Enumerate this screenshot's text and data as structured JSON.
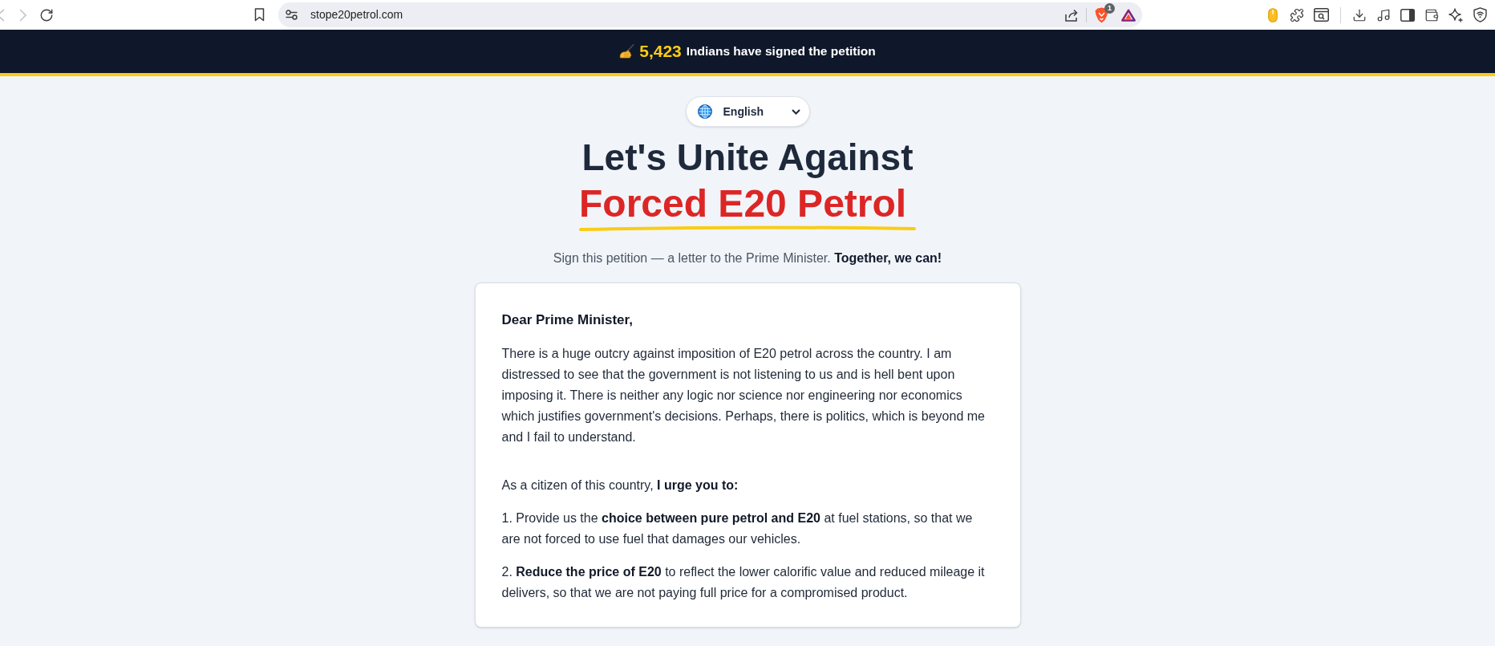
{
  "browser": {
    "nav_buttons": [
      {
        "kind": "back",
        "disabled": true
      },
      {
        "kind": "forward",
        "disabled": true
      },
      {
        "kind": "reload",
        "disabled": false
      }
    ],
    "url": "stope20petrol.com",
    "shields_badge": "1"
  },
  "banner": {
    "count": "5,423",
    "text": "Indians have signed the petition"
  },
  "language_select": {
    "value": "English"
  },
  "headline": {
    "line_1": "Let's Unite Against",
    "line_2": "Forced E20 Petrol"
  },
  "subtitle": "Sign this petition — a letter to the Prime Minister. **Together, we can!**",
  "letter": {
    "greeting": "Dear Prime Minister,",
    "body": "There is a huge outcry against imposition of E20 petrol across the country. I am distressed to see that the government is not listening to us and is hell bent upon imposing it. There is neither any logic nor science nor engineering nor economics which justifies government's decisions. Perhaps, there is politics, which is beyond me and I fail to understand.",
    "call": "As a citizen of this country, **I urge you to:**",
    "demands": [
      "1. Provide us the **choice between pure petrol and E20** at fuel stations, so that we are not forced to use fuel that damages our vehicles.",
      "2. **Reduce the price of E20** to reflect the lower calorific value and reduced mileage it delivers, so that we are not paying full price for a compromised product."
    ]
  }
}
